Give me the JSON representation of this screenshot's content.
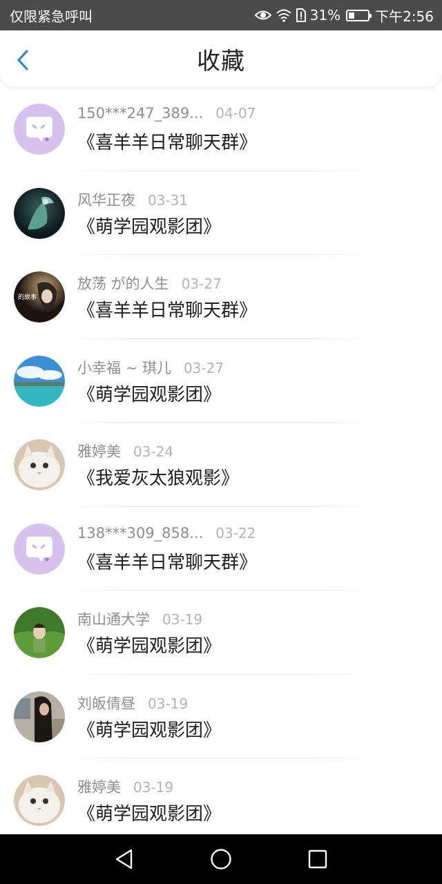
{
  "status_bar": {
    "left_text": "仅限紧急呼叫",
    "battery": "31%",
    "battery_level": 0.31,
    "time": "下午2:56"
  },
  "header": {
    "title": "收藏",
    "accent_color": "#2b8ad8"
  },
  "items": [
    {
      "user": "150***247_389...",
      "date": "04-07",
      "group": "《喜羊羊日常聊天群》",
      "avatar": "chat-bubble-avatar"
    },
    {
      "user": "风华正夜",
      "date": "03-31",
      "group": "《萌学园观影团》",
      "avatar": "photo-avatar"
    },
    {
      "user": "放荡 が的人生",
      "date": "03-27",
      "group": "《喜羊羊日常聊天群》",
      "avatar": "photo-avatar"
    },
    {
      "user": "小幸福 ~ 琪儿",
      "date": "03-27",
      "group": "《萌学园观影团》",
      "avatar": "photo-avatar"
    },
    {
      "user": "雅婷美",
      "date": "03-24",
      "group": "《我爱灰太狼观影》",
      "avatar": "cat-photo-avatar"
    },
    {
      "user": "138***309_858...",
      "date": "03-22",
      "group": "《喜羊羊日常聊天群》",
      "avatar": "chat-bubble-avatar"
    },
    {
      "user": "南山通大学",
      "date": "03-19",
      "group": "《萌学园观影团》",
      "avatar": "photo-avatar"
    },
    {
      "user": "刘皈倩昼",
      "date": "03-19",
      "group": "《萌学园观影团》",
      "avatar": "photo-avatar"
    },
    {
      "user": "雅婷美",
      "date": "03-19",
      "group": "《萌学园观影团》",
      "avatar": "cat-photo-avatar"
    }
  ],
  "nav": [
    "back-triangle-icon",
    "home-circle-icon",
    "recents-square-icon"
  ]
}
